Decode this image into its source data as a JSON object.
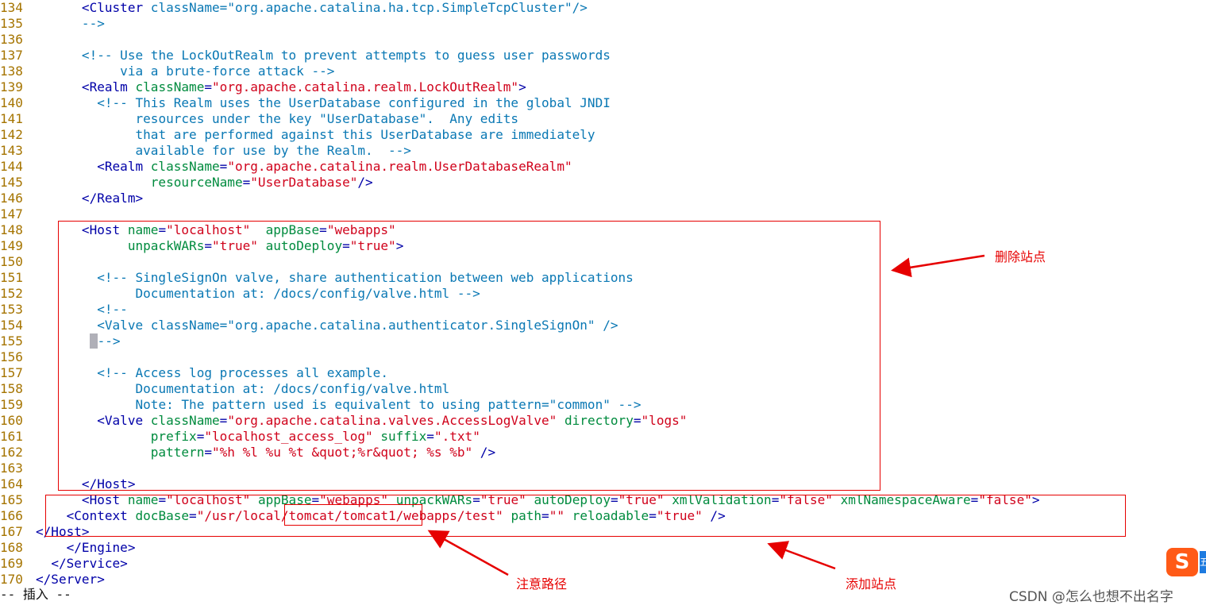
{
  "editor": {
    "lines": [
      {
        "n": "134",
        "segs": [
          [
            "",
            "      "
          ],
          [
            "t",
            "<Cluster "
          ],
          [
            "c",
            "className=\"org.apache.catalina.ha.tcp.SimpleTcpCluster\"/>"
          ]
        ]
      },
      {
        "n": "135",
        "segs": [
          [
            "",
            "      "
          ],
          [
            "c",
            "-->"
          ]
        ]
      },
      {
        "n": "136",
        "segs": []
      },
      {
        "n": "137",
        "segs": [
          [
            "",
            "      "
          ],
          [
            "c",
            "<!-- Use the LockOutRealm to prevent attempts to guess user passwords"
          ]
        ]
      },
      {
        "n": "138",
        "segs": [
          [
            "",
            "           "
          ],
          [
            "c",
            "via a brute-force attack -->"
          ]
        ]
      },
      {
        "n": "139",
        "segs": [
          [
            "",
            "      "
          ],
          [
            "t",
            "<Realm "
          ],
          [
            "a",
            "className"
          ],
          [
            "t",
            "="
          ],
          [
            "v",
            "\"org.apache.catalina.realm.LockOutRealm\""
          ],
          [
            "t",
            ">"
          ]
        ]
      },
      {
        "n": "140",
        "segs": [
          [
            "",
            "        "
          ],
          [
            "c",
            "<!-- This Realm uses the UserDatabase configured in the global JNDI"
          ]
        ]
      },
      {
        "n": "141",
        "segs": [
          [
            "",
            "             "
          ],
          [
            "c",
            "resources under the key \"UserDatabase\".  Any edits"
          ]
        ]
      },
      {
        "n": "142",
        "segs": [
          [
            "",
            "             "
          ],
          [
            "c",
            "that are performed against this UserDatabase are immediately"
          ]
        ]
      },
      {
        "n": "143",
        "segs": [
          [
            "",
            "             "
          ],
          [
            "c",
            "available for use by the Realm.  -->"
          ]
        ]
      },
      {
        "n": "144",
        "segs": [
          [
            "",
            "        "
          ],
          [
            "t",
            "<Realm "
          ],
          [
            "a",
            "className"
          ],
          [
            "t",
            "="
          ],
          [
            "v",
            "\"org.apache.catalina.realm.UserDatabaseRealm\""
          ]
        ]
      },
      {
        "n": "145",
        "segs": [
          [
            "",
            "               "
          ],
          [
            "a",
            "resourceName"
          ],
          [
            "t",
            "="
          ],
          [
            "v",
            "\"UserDatabase\""
          ],
          [
            "t",
            "/>"
          ]
        ]
      },
      {
        "n": "146",
        "segs": [
          [
            "",
            "      "
          ],
          [
            "t",
            "</Realm>"
          ]
        ]
      },
      {
        "n": "147",
        "segs": []
      },
      {
        "n": "148",
        "segs": [
          [
            "",
            "      "
          ],
          [
            "t",
            "<Host "
          ],
          [
            "a",
            "name"
          ],
          [
            "t",
            "="
          ],
          [
            "v",
            "\"localhost\""
          ],
          [
            "t",
            "  "
          ],
          [
            "a",
            "appBase"
          ],
          [
            "t",
            "="
          ],
          [
            "v",
            "\"webapps\""
          ]
        ]
      },
      {
        "n": "149",
        "segs": [
          [
            "",
            "            "
          ],
          [
            "a",
            "unpackWARs"
          ],
          [
            "t",
            "="
          ],
          [
            "v",
            "\"true\""
          ],
          [
            "t",
            " "
          ],
          [
            "a",
            "autoDeploy"
          ],
          [
            "t",
            "="
          ],
          [
            "v",
            "\"true\""
          ],
          [
            "t",
            ">"
          ]
        ]
      },
      {
        "n": "150",
        "segs": []
      },
      {
        "n": "151",
        "segs": [
          [
            "",
            "        "
          ],
          [
            "c",
            "<!-- SingleSignOn valve, share authentication between web applications"
          ]
        ]
      },
      {
        "n": "152",
        "segs": [
          [
            "",
            "             "
          ],
          [
            "c",
            "Documentation at: /docs/config/valve.html -->"
          ]
        ]
      },
      {
        "n": "153",
        "segs": [
          [
            "",
            "        "
          ],
          [
            "c",
            "<!--"
          ]
        ]
      },
      {
        "n": "154",
        "segs": [
          [
            "",
            "        "
          ],
          [
            "c",
            "<Valve className=\"org.apache.catalina.authenticator.SingleSignOn\" />"
          ]
        ]
      },
      {
        "n": "155",
        "segs": [
          [
            "",
            "       "
          ],
          [
            "cursor",
            ""
          ],
          [
            "c",
            "-->"
          ]
        ]
      },
      {
        "n": "156",
        "segs": []
      },
      {
        "n": "157",
        "segs": [
          [
            "",
            "        "
          ],
          [
            "c",
            "<!-- Access log processes all example."
          ]
        ]
      },
      {
        "n": "158",
        "segs": [
          [
            "",
            "             "
          ],
          [
            "c",
            "Documentation at: /docs/config/valve.html"
          ]
        ]
      },
      {
        "n": "159",
        "segs": [
          [
            "",
            "             "
          ],
          [
            "c",
            "Note: The pattern used is equivalent to using pattern=\"common\" -->"
          ]
        ]
      },
      {
        "n": "160",
        "segs": [
          [
            "",
            "        "
          ],
          [
            "t",
            "<Valve "
          ],
          [
            "a",
            "className"
          ],
          [
            "t",
            "="
          ],
          [
            "v",
            "\"org.apache.catalina.valves.AccessLogValve\""
          ],
          [
            "t",
            " "
          ],
          [
            "a",
            "directory"
          ],
          [
            "t",
            "="
          ],
          [
            "v",
            "\"logs\""
          ]
        ]
      },
      {
        "n": "161",
        "segs": [
          [
            "",
            "               "
          ],
          [
            "a",
            "prefix"
          ],
          [
            "t",
            "="
          ],
          [
            "v",
            "\"localhost_access_log\""
          ],
          [
            "t",
            " "
          ],
          [
            "a",
            "suffix"
          ],
          [
            "t",
            "="
          ],
          [
            "v",
            "\".txt\""
          ]
        ]
      },
      {
        "n": "162",
        "segs": [
          [
            "",
            "               "
          ],
          [
            "a",
            "pattern"
          ],
          [
            "t",
            "="
          ],
          [
            "v",
            "\"%h %l %u %t &quot;%r&quot; %s %b\""
          ],
          [
            "t",
            " />"
          ]
        ]
      },
      {
        "n": "163",
        "segs": []
      },
      {
        "n": "164",
        "segs": [
          [
            "",
            "      "
          ],
          [
            "t",
            "</Host>"
          ]
        ]
      },
      {
        "n": "165",
        "segs": [
          [
            "",
            "      "
          ],
          [
            "t",
            "<Host "
          ],
          [
            "a",
            "name"
          ],
          [
            "t",
            "="
          ],
          [
            "v",
            "\"localhost\""
          ],
          [
            "t",
            " "
          ],
          [
            "a",
            "appBase"
          ],
          [
            "t",
            "="
          ],
          [
            "v",
            "\"webapps\""
          ],
          [
            "t",
            " "
          ],
          [
            "a",
            "unpackWARs"
          ],
          [
            "t",
            "="
          ],
          [
            "v",
            "\"true\""
          ],
          [
            "t",
            " "
          ],
          [
            "a",
            "autoDeploy"
          ],
          [
            "t",
            "="
          ],
          [
            "v",
            "\"true\""
          ],
          [
            "t",
            " "
          ],
          [
            "a",
            "xmlValidation"
          ],
          [
            "t",
            "="
          ],
          [
            "v",
            "\"false\""
          ],
          [
            "t",
            " "
          ],
          [
            "a",
            "xmlNamespaceAware"
          ],
          [
            "t",
            "="
          ],
          [
            "v",
            "\"false\""
          ],
          [
            "t",
            ">"
          ]
        ]
      },
      {
        "n": "166",
        "segs": [
          [
            "",
            "    "
          ],
          [
            "t",
            "<Context "
          ],
          [
            "a",
            "docBase"
          ],
          [
            "t",
            "="
          ],
          [
            "v",
            "\"/usr/local/tomcat/tomcat1/webapps/test\""
          ],
          [
            "t",
            " "
          ],
          [
            "a",
            "path"
          ],
          [
            "t",
            "="
          ],
          [
            "v",
            "\"\""
          ],
          [
            "t",
            " "
          ],
          [
            "a",
            "reloadable"
          ],
          [
            "t",
            "="
          ],
          [
            "v",
            "\"true\""
          ],
          [
            "t",
            " />"
          ]
        ]
      },
      {
        "n": "167",
        "segs": [
          [
            "t",
            "</Host>"
          ]
        ]
      },
      {
        "n": "168",
        "segs": [
          [
            "",
            "    "
          ],
          [
            "t",
            "</Engine>"
          ]
        ]
      },
      {
        "n": "169",
        "segs": [
          [
            "",
            "  "
          ],
          [
            "t",
            "</Service>"
          ]
        ]
      },
      {
        "n": "170",
        "segs": [
          [
            "t",
            "</Server>"
          ]
        ]
      }
    ]
  },
  "statusbar": {
    "mode": "-- 插入 --"
  },
  "annotations": {
    "delete_site": "删除站点",
    "note_path": "注意路径",
    "add_site": "添加站点"
  },
  "watermark": "CSDN @怎么也想不出名字",
  "sogou_logo": "S",
  "sogou_edge": "五",
  "colors": {
    "line_number": "#a57400",
    "tag": "#0000a8",
    "attribute": "#008b3e",
    "value": "#d0021b",
    "comment": "#0a78b4",
    "annotation": "#e60000"
  }
}
